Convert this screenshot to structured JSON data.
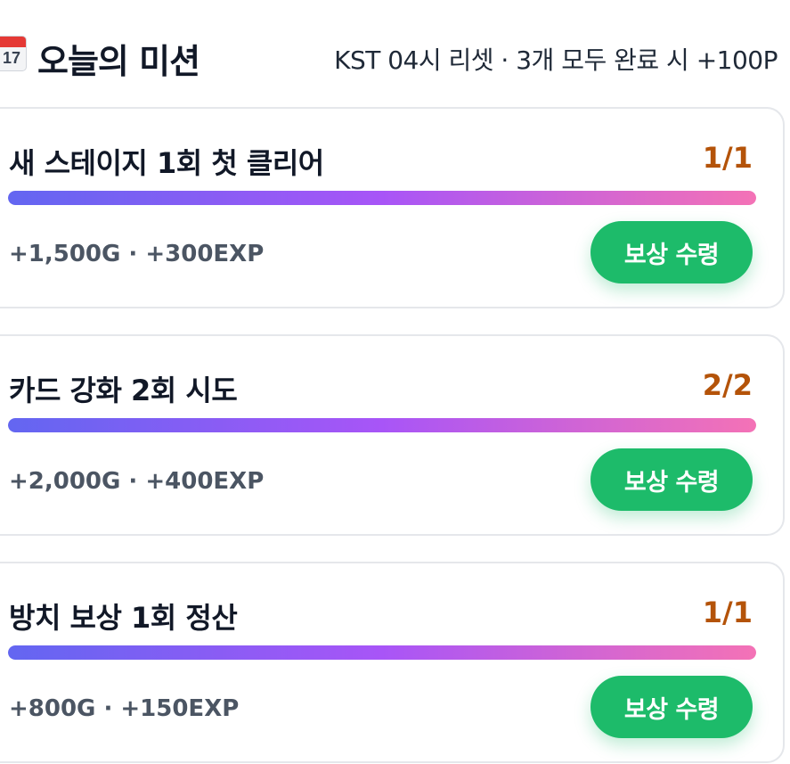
{
  "header": {
    "icon": "calendar-icon",
    "icon_day": "17",
    "title": "오늘의 미션",
    "note": "KST 04시 리셋 · 3개 모두 완료 시 +100P"
  },
  "colors": {
    "count": "#b45309",
    "progress_gradient": [
      "#6366f1",
      "#a855f7",
      "#f472b6"
    ],
    "claim_button": "#1dbb6a"
  },
  "missions": [
    {
      "title": "새 스테이지 1회 첫 클리어",
      "count": "1/1",
      "progress": 1.0,
      "reward": "+1,500G · +300EXP",
      "button_label": "보상 수령"
    },
    {
      "title": "카드 강화 2회 시도",
      "count": "2/2",
      "progress": 1.0,
      "reward": "+2,000G · +400EXP",
      "button_label": "보상 수령"
    },
    {
      "title": "방치 보상 1회 정산",
      "count": "1/1",
      "progress": 1.0,
      "reward": "+800G · +150EXP",
      "button_label": "보상 수령"
    }
  ]
}
